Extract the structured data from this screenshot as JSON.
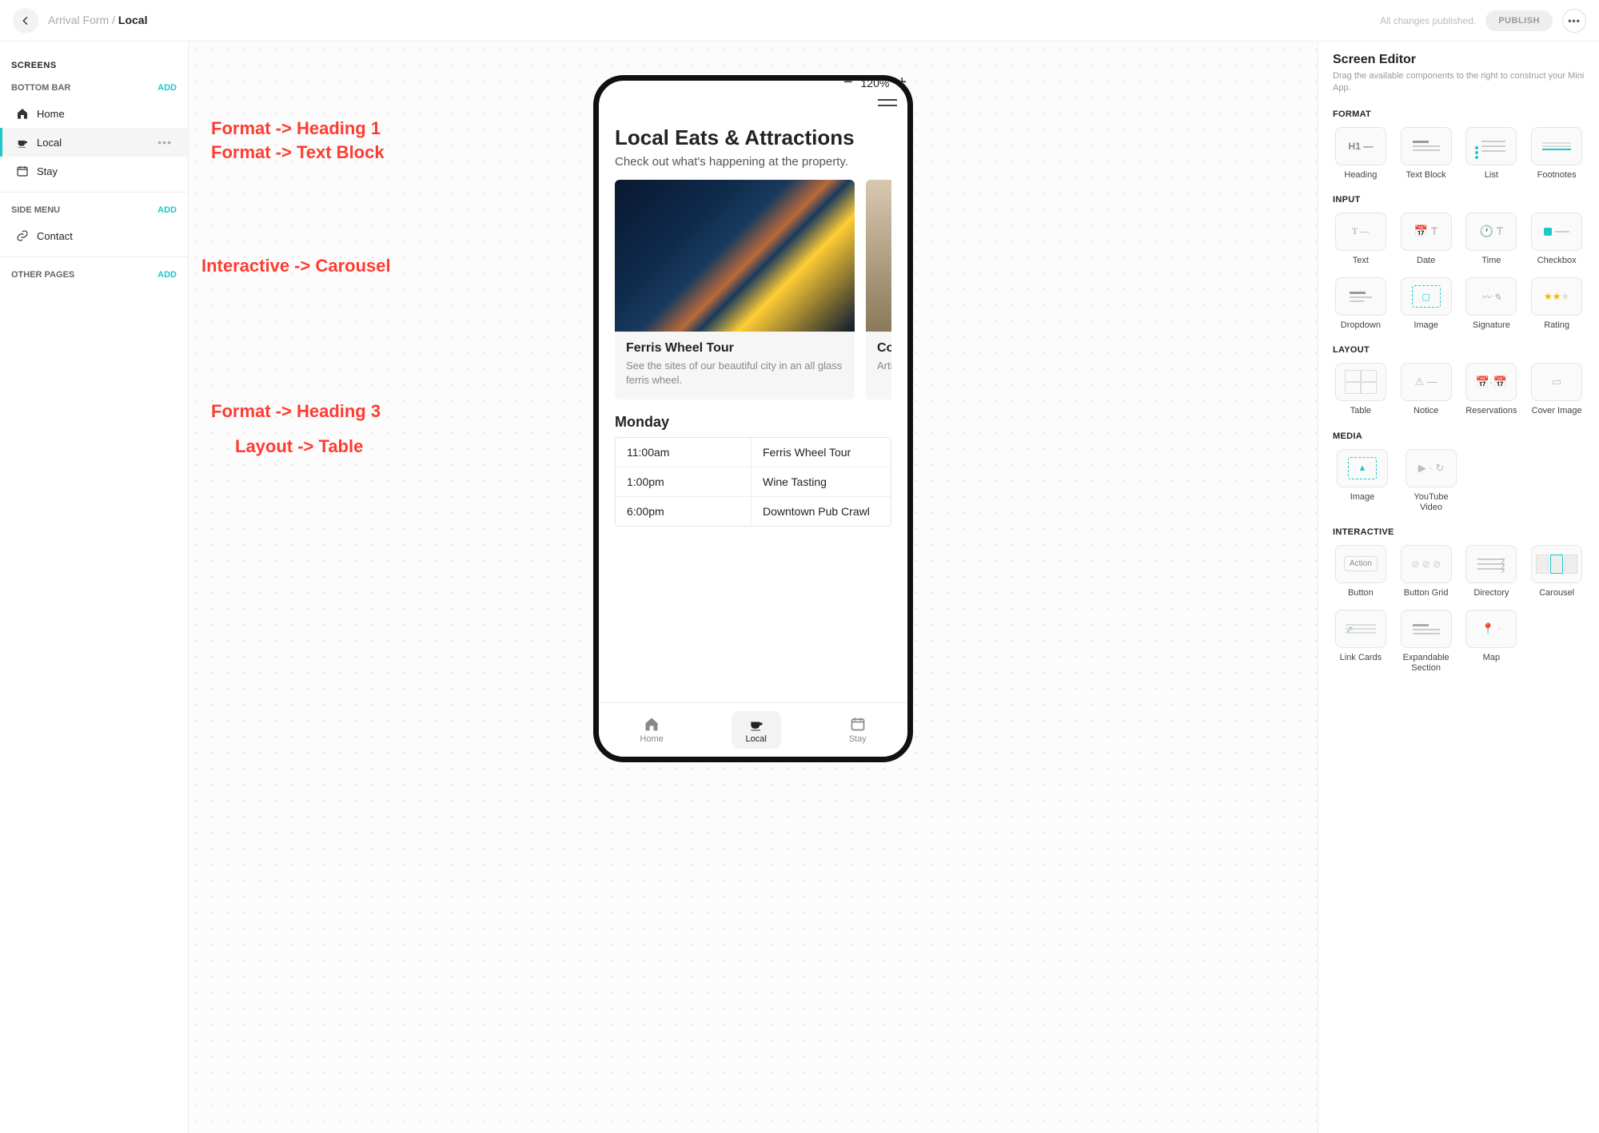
{
  "topbar": {
    "breadcrumb_parent": "Arrival Form",
    "breadcrumb_sep": " / ",
    "breadcrumb_current": "Local",
    "all_published": "All changes published.",
    "publish_label": "PUBLISH"
  },
  "sidebar": {
    "screens_header": "SCREENS",
    "bottom_bar_label": "BOTTOM BAR",
    "side_menu_label": "SIDE MENU",
    "other_pages_label": "OTHER PAGES",
    "add_label": "ADD",
    "bottom_bar_items": [
      "Home",
      "Local",
      "Stay"
    ],
    "side_menu_items": [
      "Contact"
    ]
  },
  "canvas": {
    "annotations": {
      "heading1": "Format -> Heading 1",
      "textblock": "Format -> Text Block",
      "carousel": "Interactive -> Carousel",
      "heading3": "Format -> Heading 3",
      "table": "Layout -> Table"
    },
    "zoom": "120%"
  },
  "phone": {
    "title": "Local Eats & Attractions",
    "subtitle": "Check out what's happening at the property.",
    "carousel": [
      {
        "title": "Ferris Wheel Tour",
        "desc": "See the sites of our beautiful city in an all glass ferris wheel."
      },
      {
        "title": "Co",
        "desc": "Arti cof"
      }
    ],
    "schedule_heading": "Monday",
    "schedule": [
      {
        "time": "11:00am",
        "event": "Ferris Wheel Tour"
      },
      {
        "time": "1:00pm",
        "event": "Wine Tasting"
      },
      {
        "time": "6:00pm",
        "event": "Downtown Pub Crawl"
      }
    ],
    "bottom_bar": [
      "Home",
      "Local",
      "Stay"
    ]
  },
  "rightpanel": {
    "title": "Screen Editor",
    "subtitle": "Drag the available components to the right to construct your Mini App.",
    "sections": {
      "format": {
        "label": "FORMAT",
        "items": [
          "Heading",
          "Text Block",
          "List",
          "Footnotes"
        ]
      },
      "input": {
        "label": "INPUT",
        "items": [
          "Text",
          "Date",
          "Time",
          "Checkbox",
          "Dropdown",
          "Image",
          "Signature",
          "Rating"
        ]
      },
      "layout": {
        "label": "LAYOUT",
        "items": [
          "Table",
          "Notice",
          "Reservations",
          "Cover Image"
        ]
      },
      "media": {
        "label": "MEDIA",
        "items": [
          "Image",
          "YouTube Video"
        ]
      },
      "interactive": {
        "label": "INTERACTIVE",
        "items": [
          "Button",
          "Button Grid",
          "Directory",
          "Carousel",
          "Link Cards",
          "Expandable Section",
          "Map"
        ]
      }
    }
  }
}
